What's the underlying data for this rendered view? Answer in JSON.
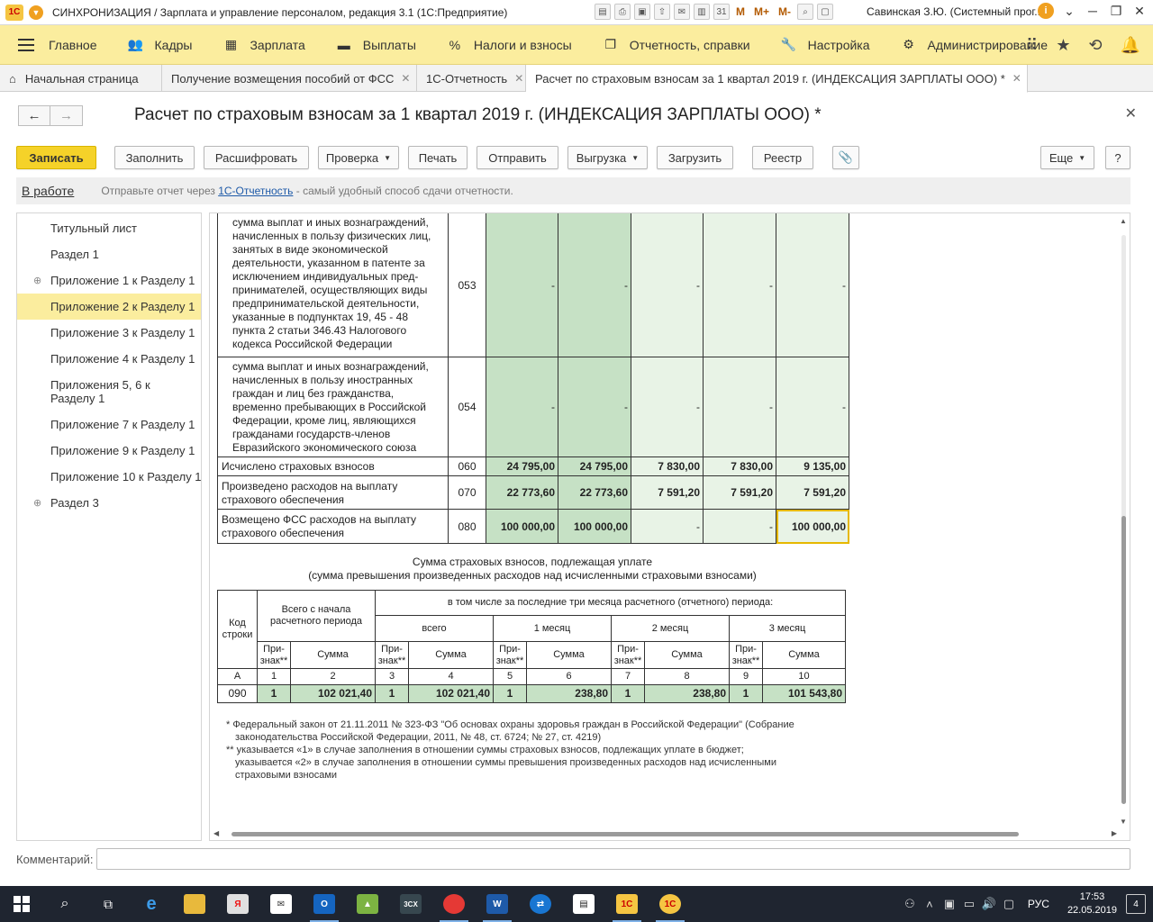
{
  "titlebar": {
    "title": "СИНХРОНИЗАЦИЯ / Зарплата и управление персоналом, редакция 3.1  (1С:Предприятие)",
    "m_buttons": [
      "M",
      "M+",
      "M-"
    ],
    "user": "Савинская З.Ю. (Системный прог..."
  },
  "main_menu": {
    "items": [
      {
        "label": "Главное",
        "icon": "home-grid-icon"
      },
      {
        "label": "Кадры",
        "icon": "people-icon"
      },
      {
        "label": "Зарплата",
        "icon": "calculator-icon"
      },
      {
        "label": "Выплаты",
        "icon": "wallet-icon"
      },
      {
        "label": "Налоги и взносы",
        "icon": "percent-icon"
      },
      {
        "label": "Отчетность, справки",
        "icon": "reports-icon"
      },
      {
        "label": "Настройка",
        "icon": "wrench-icon"
      },
      {
        "label": "Администрирование",
        "icon": "gear-icon"
      }
    ]
  },
  "tabs": [
    {
      "label": "Начальная страница"
    },
    {
      "label": "Получение возмещения пособий от ФСС"
    },
    {
      "label": "1С-Отчетность"
    },
    {
      "label": "Расчет по страховым взносам за 1 квартал 2019 г. (ИНДЕКСАЦИЯ ЗАРПЛАТЫ ООО) *"
    }
  ],
  "form": {
    "title": "Расчет по страховым взносам за 1 квартал 2019 г. (ИНДЕКСАЦИЯ ЗАРПЛАТЫ ООО) *"
  },
  "toolbar": {
    "save": "Записать",
    "fill": "Заполнить",
    "decode": "Расшифровать",
    "check": "Проверка",
    "print": "Печать",
    "send": "Отправить",
    "export": "Выгрузка",
    "upload": "Загрузить",
    "registry": "Реестр",
    "more": "Еще",
    "help": "?"
  },
  "infobar": {
    "status": "В работе",
    "text_before": "Отправьте отчет через ",
    "link": "1С-Отчетность",
    "text_after": " - самый удобный способ сдачи отчетности."
  },
  "nav": {
    "items": [
      {
        "label": "Титульный лист"
      },
      {
        "label": "Раздел 1"
      },
      {
        "label": "Приложение 1 к Разделу 1"
      },
      {
        "label": "Приложение 2 к Разделу 1"
      },
      {
        "label": "Приложение 3 к Разделу 1"
      },
      {
        "label": "Приложение 4 к Разделу 1"
      },
      {
        "label": "Приложения 5, 6 к Разделу 1"
      },
      {
        "label": "Приложение 7 к Разделу 1"
      },
      {
        "label": "Приложение 9 к Разделу 1"
      },
      {
        "label": "Приложение 10 к Разделу 1"
      },
      {
        "label": "Раздел 3"
      }
    ]
  },
  "report": {
    "rows": [
      {
        "desc": "сумма выплат и иных вознаграждений, начисленных в пользу физических лиц, занятых в виде экономической деятельности, указанном в патенте за исключением индивидуальных пред-принимателей, осуществляющих виды предпринимательской деятельности, указанные в подпунктах 19, 45 - 48 пункта 2 статьи 346.43 Налогового кодекса Российской Федерации",
        "code": "053",
        "v1": "-",
        "v2": "-",
        "v3": "-",
        "v4": "-",
        "v5": "-"
      },
      {
        "desc": "сумма выплат и иных вознаграждений, начисленных в пользу иностранных граждан и лиц без гражданства, временно пребывающих в Российской Федерации, кроме лиц, являющихся гражданами государств-членов Евразийского экономического союза",
        "code": "054",
        "v1": "-",
        "v2": "-",
        "v3": "-",
        "v4": "-",
        "v5": "-"
      },
      {
        "desc": "Исчислено страховых взносов",
        "code": "060",
        "v1": "24 795,00",
        "v2": "24 795,00",
        "v3": "7 830,00",
        "v4": "7 830,00",
        "v5": "9 135,00"
      },
      {
        "desc": "Произведено расходов на выплату страхового обеспечения",
        "code": "070",
        "v1": "22 773,60",
        "v2": "22 773,60",
        "v3": "7 591,20",
        "v4": "7 591,20",
        "v5": "7 591,20"
      },
      {
        "desc": "Возмещено ФСС расходов на выплату страхового обеспечения",
        "code": "080",
        "v1": "100 000,00",
        "v2": "100 000,00",
        "v3": "-",
        "v4": "-",
        "v5": "100 000,00"
      }
    ],
    "summary_title_1": "Сумма страховых взносов, подлежащая уплате",
    "summary_title_2": "(сумма превышения произведенных расходов над исчисленными страховыми взносами)",
    "sum_table": {
      "h_code": "Код строки",
      "h_total": "Всего с начала расчетного периода",
      "h_last3": "в том числе за последние три месяца расчетного (отчетного) периода:",
      "h_all": "всего",
      "h_m1": "1 месяц",
      "h_m2": "2 месяц",
      "h_m3": "3 месяц",
      "h_sign": "При-знак**",
      "h_sum": "Сумма",
      "nums": [
        "А",
        "1",
        "2",
        "3",
        "4",
        "5",
        "6",
        "7",
        "8",
        "9",
        "10"
      ],
      "row": {
        "code": "090",
        "s1": "1",
        "a1": "102 021,40",
        "s2": "1",
        "a2": "102 021,40",
        "s3": "1",
        "a3": "238,80",
        "s4": "1",
        "a4": "238,80",
        "s5": "1",
        "a5": "101 543,80"
      }
    },
    "footnote_1a": "*  Федеральный закон от 21.11.2011 № 323-ФЗ \"Об основах охраны здоровья граждан в Российской Федерации\" (Собрание",
    "footnote_1b": "законодательства Российской Федерации, 2011, № 48, ст. 6724; № 27, ст. 4219)",
    "footnote_2a": "** указывается «1» в случае заполнения в отношении суммы страховых взносов, подлежащих уплате в бюджет;",
    "footnote_2b": "указывается «2» в случае заполнения в отношении суммы превышения произведенных расходов над исчисленными",
    "footnote_2c": "страховыми взносами"
  },
  "comment": {
    "label": "Комментарий:",
    "value": ""
  },
  "taskbar": {
    "lang": "РУС",
    "time": "17:53",
    "date": "22.05.2019",
    "notifications": "4"
  },
  "colors": {
    "accent_yellow": "#f5d229",
    "menu_bg": "#fbed9e",
    "cell_green": "#c6e1c5",
    "cell_light": "#e8f3e6"
  }
}
